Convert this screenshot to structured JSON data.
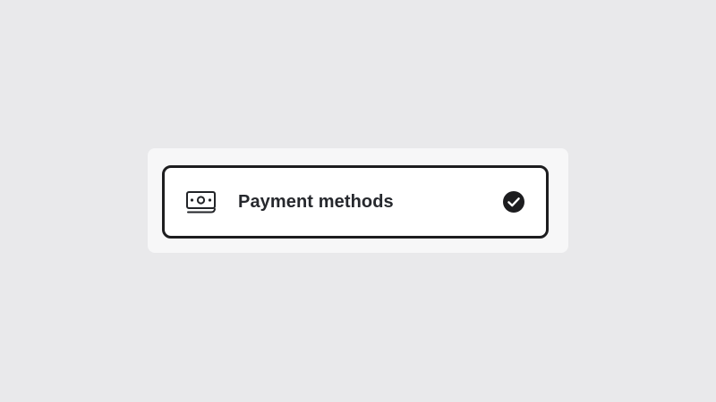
{
  "payment_option": {
    "label": "Payment methods",
    "icon": "money-bill-icon",
    "selected": true,
    "status_icon": "check-circle-icon"
  },
  "colors": {
    "page_background": "#e9e9eb",
    "panel_background": "#f7f7f8",
    "card_border": "#1d1d1f",
    "text": "#26282d"
  }
}
